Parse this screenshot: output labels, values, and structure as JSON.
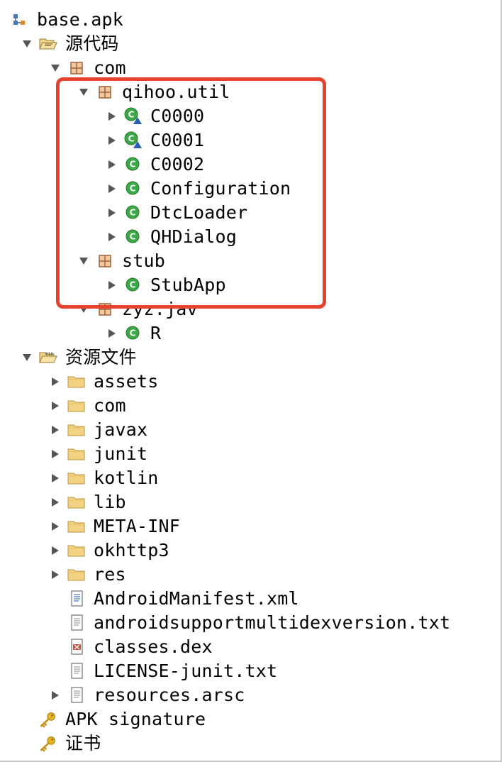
{
  "tree": [
    {
      "id": "root",
      "depth": 0,
      "icon": "apk",
      "twisty": "",
      "label": "base.apk"
    },
    {
      "id": "src",
      "depth": 1,
      "icon": "folder-open-src",
      "twisty": "open",
      "label": "源代码"
    },
    {
      "id": "com",
      "depth": 2,
      "icon": "package",
      "twisty": "open",
      "label": "com"
    },
    {
      "id": "qihoo",
      "depth": 3,
      "icon": "package",
      "twisty": "open",
      "label": "qihoo.util"
    },
    {
      "id": "c0000",
      "depth": 4,
      "icon": "class-warn",
      "twisty": "closed",
      "label": "C0000"
    },
    {
      "id": "c0001",
      "depth": 4,
      "icon": "class-warn",
      "twisty": "closed",
      "label": "C0001"
    },
    {
      "id": "c0002",
      "depth": 4,
      "icon": "class",
      "twisty": "closed",
      "label": "C0002"
    },
    {
      "id": "config",
      "depth": 4,
      "icon": "class",
      "twisty": "closed",
      "label": "Configuration"
    },
    {
      "id": "dtc",
      "depth": 4,
      "icon": "class",
      "twisty": "closed",
      "label": "DtcLoader"
    },
    {
      "id": "qhd",
      "depth": 4,
      "icon": "class",
      "twisty": "closed",
      "label": "QHDialog"
    },
    {
      "id": "stub",
      "depth": 3,
      "icon": "package",
      "twisty": "open",
      "label": "stub"
    },
    {
      "id": "stubapp",
      "depth": 4,
      "icon": "class",
      "twisty": "closed",
      "label": "StubApp"
    },
    {
      "id": "zyz",
      "depth": 3,
      "icon": "package",
      "twisty": "open",
      "label": "zyz.jav"
    },
    {
      "id": "r",
      "depth": 4,
      "icon": "class",
      "twisty": "closed",
      "label": "R"
    },
    {
      "id": "res",
      "depth": 1,
      "icon": "folder-open-res",
      "twisty": "open",
      "label": "资源文件"
    },
    {
      "id": "assets",
      "depth": 2,
      "icon": "folder",
      "twisty": "closed",
      "label": "assets"
    },
    {
      "id": "rcom",
      "depth": 2,
      "icon": "folder",
      "twisty": "closed",
      "label": "com"
    },
    {
      "id": "javax",
      "depth": 2,
      "icon": "folder",
      "twisty": "closed",
      "label": "javax"
    },
    {
      "id": "junit",
      "depth": 2,
      "icon": "folder",
      "twisty": "closed",
      "label": "junit"
    },
    {
      "id": "kotlin",
      "depth": 2,
      "icon": "folder",
      "twisty": "closed",
      "label": "kotlin"
    },
    {
      "id": "lib",
      "depth": 2,
      "icon": "folder",
      "twisty": "closed",
      "label": "lib"
    },
    {
      "id": "meta",
      "depth": 2,
      "icon": "folder",
      "twisty": "closed",
      "label": "META-INF"
    },
    {
      "id": "okhttp3",
      "depth": 2,
      "icon": "folder",
      "twisty": "closed",
      "label": "okhttp3"
    },
    {
      "id": "resdir",
      "depth": 2,
      "icon": "folder",
      "twisty": "closed",
      "label": "res"
    },
    {
      "id": "manifest",
      "depth": 2,
      "icon": "file-xml",
      "twisty": "",
      "label": "AndroidManifest.xml"
    },
    {
      "id": "multidex",
      "depth": 2,
      "icon": "file-text",
      "twisty": "",
      "label": "androidsupportmultidexversion.txt"
    },
    {
      "id": "dex",
      "depth": 2,
      "icon": "file-dex",
      "twisty": "",
      "label": "classes.dex"
    },
    {
      "id": "license",
      "depth": 2,
      "icon": "file-text",
      "twisty": "",
      "label": "LICENSE-junit.txt"
    },
    {
      "id": "arsc",
      "depth": 2,
      "icon": "file-text",
      "twisty": "closed",
      "label": "resources.arsc"
    },
    {
      "id": "apksig",
      "depth": 1,
      "icon": "key",
      "twisty": "",
      "label": "APK signature"
    },
    {
      "id": "cert",
      "depth": 1,
      "icon": "key",
      "twisty": "",
      "label": "证书"
    }
  ],
  "colors": {
    "highlight": "#e8412c",
    "class_green": "#3aa845",
    "folder": "#f2d383",
    "package": "#b5744a"
  }
}
